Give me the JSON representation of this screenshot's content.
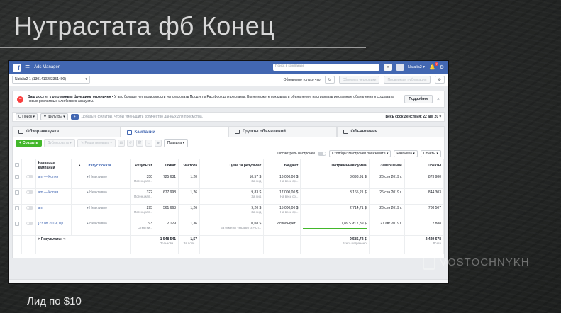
{
  "slide": {
    "title": "Нутрастата фб Конец",
    "footer": "Лид по $10"
  },
  "topbar": {
    "logo": "f",
    "menu_icon": "☰",
    "app_title": "Ads Manager",
    "search_placeholder": "Поиск в компании",
    "user": "Natalia2 ▾",
    "notif_count": "7"
  },
  "account_bar": {
    "account": "Natalia2-1 (1301410283351400)",
    "updated": "Обновлено только что",
    "discard": "Сбросить черновики",
    "review": "Проверка и публикация"
  },
  "alert": {
    "title": "Ваш доступ к рекламным функциям ограничен •",
    "text": "У вас больше нет возможности использовать Продукты Facebook для рекламы. Вы не можете показывать объявления, настраивать рекламные объявления и создавать новые рекламные или бизнес-аккаунты.",
    "more": "Подробнее",
    "close": "×"
  },
  "filters": {
    "search": "Q Поиск ▾",
    "filters": "▼ Фильтры ▾",
    "plus": "+",
    "hint": "Добавьте фильтры, чтобы уменьшить количество данных для просмотра.",
    "date": "Весь срок действия: 22 авг 20 ▾"
  },
  "tabs": [
    {
      "label": "Обзор аккаунта"
    },
    {
      "label": "Кампании"
    },
    {
      "label": "Группы объявлений"
    },
    {
      "label": "Объявления"
    }
  ],
  "actions": {
    "create": "+ Создать",
    "duplicate": "Дублировать ▾",
    "edit": "✎ Редактировать ▾",
    "rules": "Правила ▾"
  },
  "view_bar": {
    "preview": "Посмотреть настройки",
    "columns": "Столбцы: Настройки пользовате ▾",
    "breakdown": "Разбивка ▾",
    "reports": "Отчеты ▾"
  },
  "table": {
    "headers": [
      "Название кампании",
      "Статус показа",
      "Результат",
      "Охват",
      "Частота",
      "Цена за результат",
      "Бюджет",
      "Потраченная сумма",
      "Завершение",
      "Показы"
    ],
    "rows": [
      {
        "name": "am — Копия",
        "status": "● Неактивно",
        "result": "350",
        "result_sub": "Потенциал...",
        "reach": "725 631",
        "freq": "1,20",
        "cpr": "10,57 $",
        "cpr_sub": "За лид",
        "budget": "16 000,00 $",
        "budget_sub": "На весь ср...",
        "spent": "3 698,91 $",
        "end": "26 сен 2019 г.",
        "impr": "873 980"
      },
      {
        "name": "am — Копия",
        "status": "● Неактивно",
        "result": "322",
        "result_sub": "Потенциал...",
        "reach": "677 998",
        "freq": "1,26",
        "cpr": "9,83 $",
        "cpr_sub": "За лид",
        "budget": "17 000,00 $",
        "budget_sub": "На весь ср...",
        "spent": "3 165,21 $",
        "end": "26 сен 2019 г.",
        "impr": "844 303"
      },
      {
        "name": "am",
        "status": "● Неактивно",
        "result": "295",
        "result_sub": "Потенциал...",
        "reach": "561 663",
        "freq": "1,26",
        "cpr": "9,20 $",
        "cpr_sub": "За лид",
        "budget": "15 000,00 $",
        "budget_sub": "На весь ср...",
        "spent": "2 714,71 $",
        "end": "26 сен 2019 г.",
        "impr": "708 507"
      },
      {
        "name": "[23.08.2019] Пр...",
        "status": "● Неактивно",
        "result": "93",
        "result_sub": "Отметки...",
        "reach": "2 129",
        "freq": "1,36",
        "cpr": "0,08 $",
        "cpr_sub": "За отметку «Нравится» Ст...",
        "budget": "Использует...",
        "budget_sub": "",
        "spent": "7,89 $ из 7,89 $",
        "end": "27 авг 2019 г.",
        "impr": "2 888"
      }
    ],
    "total": {
      "label": "> Результаты, ч",
      "result": "—",
      "reach": "1 548 541",
      "reach_sub": "Пользова...",
      "freq": "1,57",
      "freq_sub": "За поль...",
      "cpr": "—",
      "spent": "9 586,72 $",
      "spent_sub": "Всего потрачено",
      "impr": "2 429 678",
      "impr_sub": "Всего"
    }
  },
  "watermark": "VOSTOCHNYKH"
}
